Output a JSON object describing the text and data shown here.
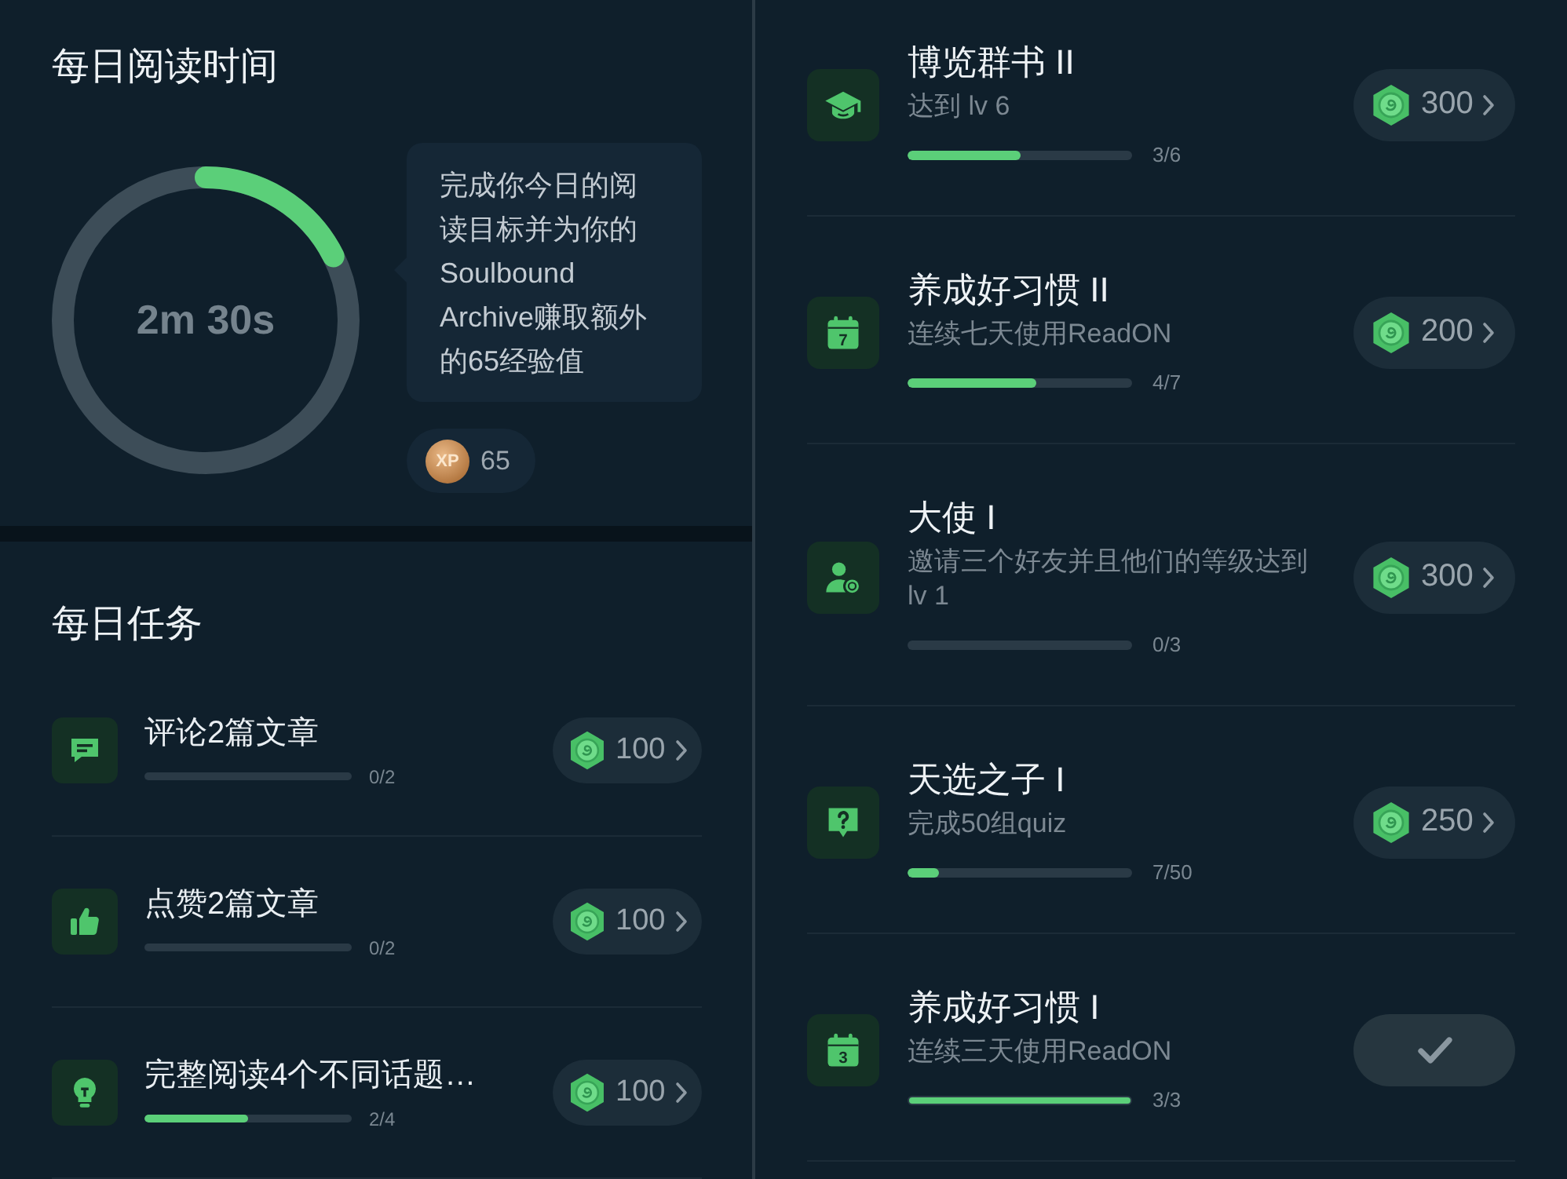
{
  "reading_time": {
    "title": "每日阅读时间",
    "level": 0.19,
    "time": "2m 30s",
    "tip": "完成你今日的阅读目标并为你的Soulbound Archive赚取额外的65经验值",
    "xp": {
      "coin_label": "XP",
      "value": "65"
    }
  },
  "daily_tasks": {
    "title": "每日任务",
    "items": [
      {
        "kind": "comment",
        "title": "评论2篇文章",
        "level": 0,
        "progress": "0/2",
        "reward": "100"
      },
      {
        "kind": "thumbs-up",
        "title": "点赞2篇文章",
        "level": 0,
        "progress": "0/2",
        "reward": "100"
      },
      {
        "kind": "lightbulb",
        "title": "完整阅读4个不同话题…",
        "level": 0.5,
        "progress": "2/4",
        "reward": "100"
      }
    ]
  },
  "achievements": [
    {
      "kind": "graduation-cap",
      "title": "博览群书 II",
      "description": "达到 lv 6",
      "level": 0.5,
      "progress": "3/6",
      "reward": "300",
      "claimed": false
    },
    {
      "kind": "calendar",
      "icon_label": "7",
      "title": "养成好习惯 II",
      "description": "连续七天使用ReadON",
      "level": 0.57,
      "progress": "4/7",
      "reward": "200",
      "claimed": false
    },
    {
      "kind": "person-coin",
      "title": "大使 I",
      "description": "邀请三个好友并且他们的等级达到 lv 1",
      "level": 0,
      "progress": "0/3",
      "reward": "300",
      "claimed": false
    },
    {
      "kind": "question",
      "title": "天选之子 I",
      "description": "完成50组quiz",
      "level": 0.14,
      "progress": "7/50",
      "reward": "250",
      "claimed": false
    },
    {
      "kind": "calendar",
      "icon_label": "3",
      "title": "养成好习惯 I",
      "description": "连续三天使用ReadON",
      "level": 1,
      "progress": "3/3",
      "claimed": true
    }
  ]
}
